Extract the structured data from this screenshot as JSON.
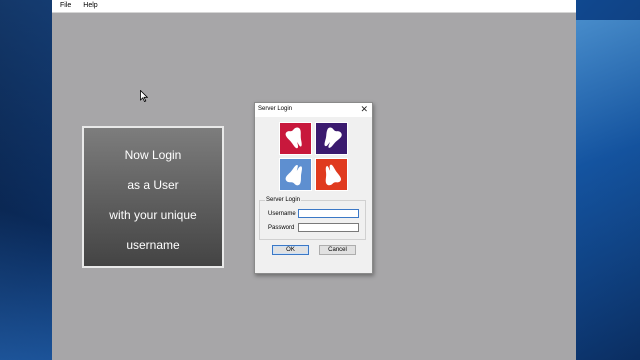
{
  "menubar": {
    "items": [
      "File",
      "Help"
    ]
  },
  "info_panel": {
    "lines": [
      "Now Login",
      "as a User",
      "with your unique",
      "username"
    ]
  },
  "dialog": {
    "title": "Server Login",
    "close_glyph": "✕",
    "logo_tiles": [
      {
        "icon": "tooth-icon",
        "color": "#c8183c"
      },
      {
        "icon": "tooth-icon",
        "color": "#3a1a6e"
      },
      {
        "icon": "tooth-icon",
        "color": "#5e8fd0"
      },
      {
        "icon": "tooth-icon",
        "color": "#e03a1e"
      }
    ],
    "group_label": "Server Login",
    "username_label": "Username",
    "username_value": "",
    "password_label": "Password",
    "password_value": "",
    "ok_label": "OK",
    "cancel_label": "Cancel"
  }
}
